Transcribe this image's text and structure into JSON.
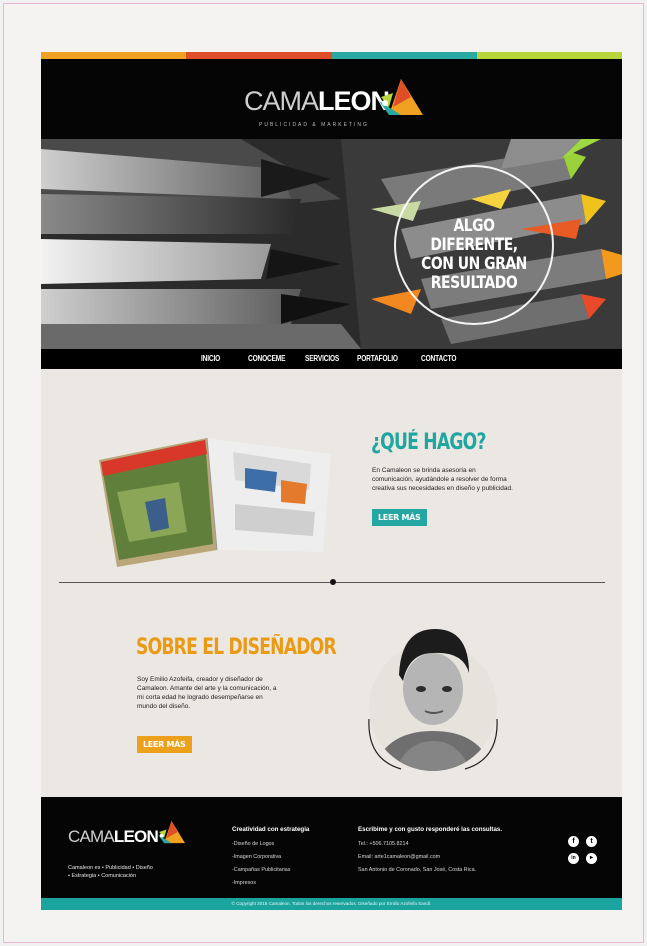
{
  "colors": {
    "teal": "#20a6a1",
    "orange": "#eb9a14",
    "strip": [
      "#f0a122",
      "#e04e27",
      "#28a9a2",
      "#b8d53b"
    ]
  },
  "brand": {
    "name_light": "CAMA",
    "name_bold": "LEON",
    "tagline": "PUBLICIDAD & MARKETING"
  },
  "hero": {
    "line1": "ALGO DIFERENTE,",
    "line2": "CON UN GRAN",
    "line3": "RESULTADO"
  },
  "nav": {
    "items": [
      "INICIO",
      "CONOCEME",
      "SERVICIOS",
      "PORTAFOLIO",
      "CONTACTO"
    ]
  },
  "que_hago": {
    "title": "¿QUÉ HAGO?",
    "lines": [
      "En Camaleon se brinda asesoría en",
      "comunicación, ayudándole a resolver de forma",
      "creativa sus necesidades en diseño y publicidad."
    ],
    "button": "LEER MÁS"
  },
  "sobre": {
    "title": "SOBRE EL DISEÑADOR",
    "lines": [
      "Soy Emilio Azofeifa, creador y diseñador de",
      "Camaleon. Amante del arte y la comunicación, a",
      "mi corta edad he logrado desempeñarse en",
      "mundo del diseño."
    ],
    "button": "LEER MÁS"
  },
  "footer": {
    "brand_line1": "Camaleon es • Publicidad • Diseño",
    "brand_line2": "• Estrategia • Comunicación",
    "services_title": "Creatividad con estrategia",
    "services": [
      "-Diseño de Logos",
      "-Imagen Corporativa",
      "-Campañas Publicitarias",
      "-Impresos"
    ],
    "contact_title": "Escribime y con gusto responderé las consultas.",
    "phone": "Tel.: +506.7105.8214",
    "email": "Email: arte1camaleon@gmail.com",
    "address": "San Antonio de Coronado, San José, Costa Rica.",
    "social": [
      "f",
      "t",
      "in",
      "▸"
    ],
    "copyright": "© Copyright 2015 Camaleon. Todos los derechos reservados. Diseñado por Emilio Azofeifa Sandí."
  }
}
